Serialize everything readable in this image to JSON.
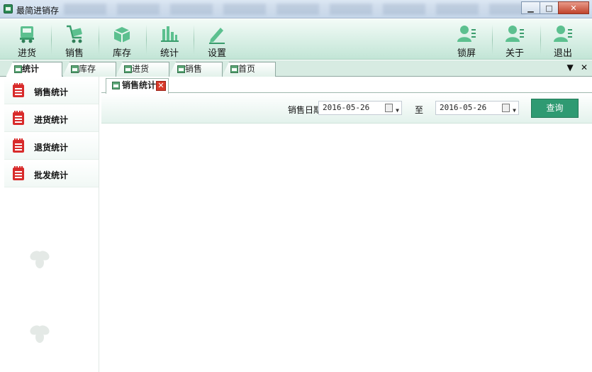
{
  "window": {
    "title": "最简进销存",
    "minimize_glyph": "▁",
    "maximize_glyph": "□",
    "close_glyph": "✕"
  },
  "toolbar": {
    "items_left": [
      {
        "label": "进货",
        "icon": "truck-icon"
      },
      {
        "label": "销售",
        "icon": "cart-icon"
      },
      {
        "label": "库存",
        "icon": "box-icon"
      },
      {
        "label": "统计",
        "icon": "bar-chart-icon"
      },
      {
        "label": "设置",
        "icon": "pencil-icon"
      }
    ],
    "items_right": [
      {
        "label": "锁屏",
        "icon": "user-icon"
      },
      {
        "label": "关于",
        "icon": "user-icon"
      },
      {
        "label": "退出",
        "icon": "user-icon"
      }
    ]
  },
  "doc_tabs": [
    {
      "label": "统计",
      "active": true
    },
    {
      "label": "库存",
      "active": false
    },
    {
      "label": "进货",
      "active": false
    },
    {
      "label": "销售",
      "active": false
    },
    {
      "label": "首页",
      "active": false
    }
  ],
  "strip_controls": {
    "dropdown": "▼",
    "close": "✕"
  },
  "left_nav": [
    {
      "label": "销售统计",
      "icon": "notepad-icon"
    },
    {
      "label": "进货统计",
      "icon": "notepad-icon"
    },
    {
      "label": "退货统计",
      "icon": "notepad-icon"
    },
    {
      "label": "批发统计",
      "icon": "notepad-icon"
    }
  ],
  "inner_tab": {
    "label": "销售统计",
    "close_glyph": "✕"
  },
  "filter": {
    "date_label": "销售日期",
    "start_date": "2016-05-26",
    "separator": "至",
    "end_date": "2016-05-26",
    "query_button": "查询"
  },
  "colors": {
    "accent": "#2f9a72",
    "toolbar_bg": "#d8efe5",
    "nav_icon": "#d82b2b"
  }
}
